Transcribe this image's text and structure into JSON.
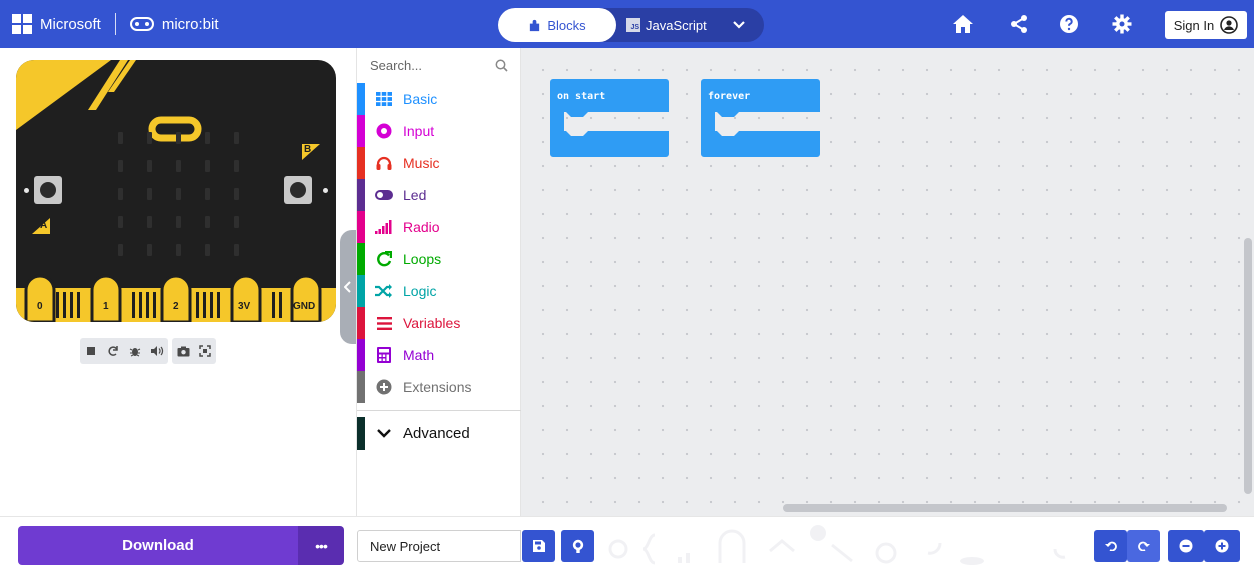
{
  "header": {
    "brand_microsoft": "Microsoft",
    "brand_microbit": "micro:bit",
    "tab_blocks": "Blocks",
    "tab_javascript": "JavaScript",
    "js_badge": "JS",
    "signin_label": "Sign In",
    "icons": [
      "home-icon",
      "share-icon",
      "help-icon",
      "settings-icon"
    ]
  },
  "simulator": {
    "board_color": "#1f1f1f",
    "accent_color": "#f5c72a",
    "button_a": "A",
    "button_b": "B",
    "pins": [
      "0",
      "1",
      "2",
      "3V",
      "GND"
    ],
    "controls": [
      "stop-icon",
      "restart-icon",
      "debug-icon",
      "mute-icon",
      "screenshot-icon",
      "fullscreen-icon"
    ]
  },
  "toolbox": {
    "search_placeholder": "Search...",
    "categories": [
      {
        "label": "Basic",
        "color": "#1e90ff",
        "icon": "grid-icon"
      },
      {
        "label": "Input",
        "color": "#d400d4",
        "icon": "input-icon"
      },
      {
        "label": "Music",
        "color": "#e63022",
        "icon": "headphones-icon"
      },
      {
        "label": "Led",
        "color": "#5c2d91",
        "icon": "toggle-icon"
      },
      {
        "label": "Radio",
        "color": "#e3008c",
        "icon": "signal-icon"
      },
      {
        "label": "Loops",
        "color": "#00aa00",
        "icon": "loop-icon"
      },
      {
        "label": "Logic",
        "color": "#00a4a6",
        "icon": "shuffle-icon"
      },
      {
        "label": "Variables",
        "color": "#dc143c",
        "icon": "lines-icon"
      },
      {
        "label": "Math",
        "color": "#9400d3",
        "icon": "calculator-icon"
      },
      {
        "label": "Extensions",
        "color": "#717171",
        "icon": "plus-icon"
      }
    ],
    "advanced": {
      "label": "Advanced",
      "color": "#0b2f2b",
      "icon": "chevron-down-icon"
    }
  },
  "workspace": {
    "blocks": [
      {
        "label": "on start",
        "color": "#2f9cf4"
      },
      {
        "label": "forever",
        "color": "#2f9cf4"
      }
    ]
  },
  "footer": {
    "download_label": "Download",
    "more_label": "•••",
    "project_name": "New Project",
    "download_color": "#6f3bd1",
    "accent_color": "#3454d1"
  }
}
